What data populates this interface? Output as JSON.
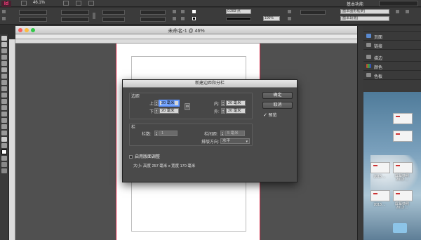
{
  "app": {
    "logo": "Id",
    "zoom": "46.1%",
    "workspace": "基本功能",
    "search_placeholder": ""
  },
  "control_bar": {
    "stroke_weight": "0.283 点",
    "fill_percent": "100%",
    "frame_label": "[基本图形框架]",
    "para_label": "[基本段落]"
  },
  "document": {
    "title": "未命名-1 @ 46%"
  },
  "panels": [
    {
      "label": "页面",
      "icon": "pages-icon",
      "color": "#5a8ad0"
    },
    {
      "label": "链接",
      "icon": "links-icon",
      "color": "#8a8a8a"
    },
    {
      "label": "描边",
      "icon": "stroke-icon",
      "color": "#8a8a8a"
    },
    {
      "label": "颜色",
      "icon": "color-icon",
      "color": "#8a8a8a"
    },
    {
      "label": "色板",
      "icon": "swatches-icon",
      "color": "#8a8a8a"
    }
  ],
  "desktop": {
    "thumb_captions": [
      "2013 ...",
      "2013 ...",
      "2013 ...",
      "2013 ..."
    ],
    "thumb_labels": [
      "屏幕快照",
      "屏幕快照"
    ]
  },
  "dialog": {
    "title": "新建边距和分栏",
    "margins_group": "边距",
    "top_label": "上:",
    "top_value": "20 毫米",
    "bottom_label": "下:",
    "bottom_value": "20 毫米",
    "inside_label": "内:",
    "inside_value": "20 毫米",
    "outside_label": "外:",
    "outside_value": "20 毫米",
    "columns_group": "栏",
    "columns_label": "栏数:",
    "columns_value": "1",
    "gutter_label": "栏间距:",
    "gutter_value": "5 毫米",
    "direction_label": "排版方向:",
    "direction_value": "水平",
    "layout_adjust_label": "启用版面调整",
    "size_summary": "大小: 高度 257 毫米 x 宽度 170 毫米",
    "ok_label": "确定",
    "cancel_label": "取消",
    "preview_label": "预览",
    "preview_checked": true
  }
}
